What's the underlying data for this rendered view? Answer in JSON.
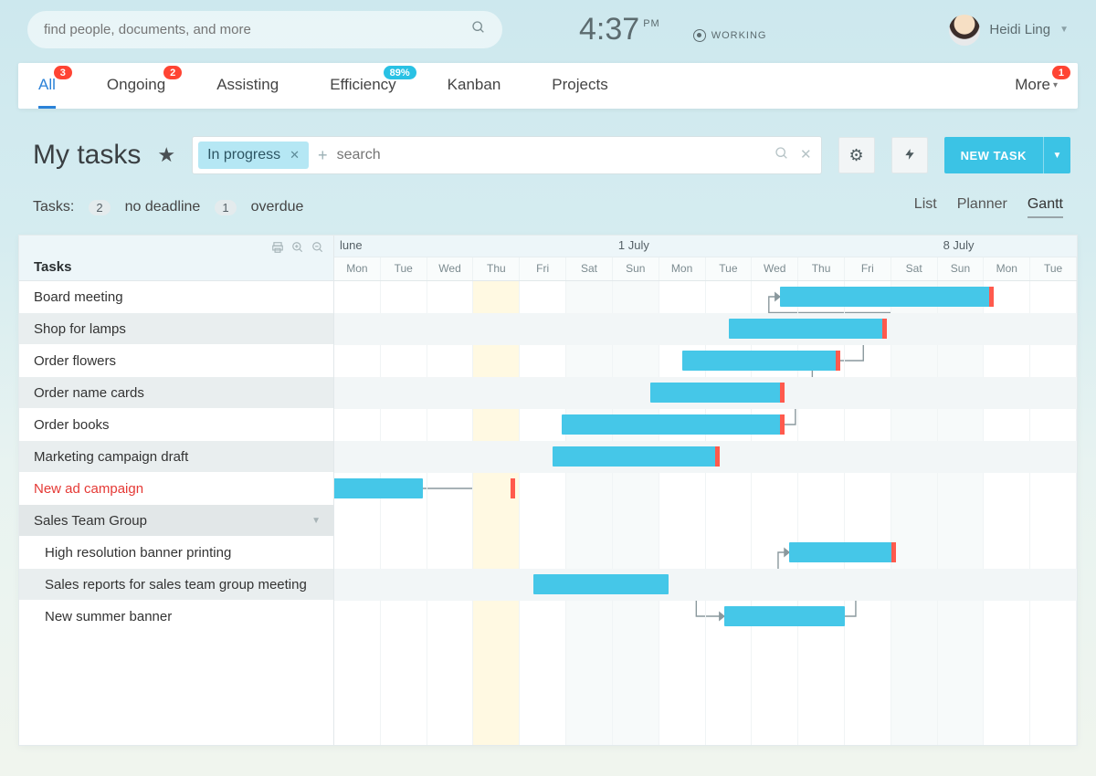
{
  "header": {
    "search_placeholder": "find people, documents, and more",
    "time": "4:37",
    "ampm": "PM",
    "status": "WORKING",
    "user_name": "Heidi Ling"
  },
  "tabs": {
    "items": [
      {
        "label": "All",
        "badge": "3",
        "badge_kind": "red",
        "active": true
      },
      {
        "label": "Ongoing",
        "badge": "2",
        "badge_kind": "red"
      },
      {
        "label": "Assisting"
      },
      {
        "label": "Efficiency",
        "badge": "89%",
        "badge_kind": "teal"
      },
      {
        "label": "Kanban"
      },
      {
        "label": "Projects"
      }
    ],
    "more_label": "More",
    "more_badge": "1"
  },
  "title": {
    "page_title": "My tasks",
    "filter_chip": "In progress",
    "filter_placeholder": "search",
    "new_task_label": "NEW TASK"
  },
  "status_row": {
    "prefix": "Tasks:",
    "no_deadline_count": "2",
    "no_deadline_label": "no deadline",
    "overdue_count": "1",
    "overdue_label": "overdue",
    "views": [
      {
        "label": "List"
      },
      {
        "label": "Planner"
      },
      {
        "label": "Gantt",
        "active": true
      }
    ]
  },
  "gantt": {
    "tasks_header": "Tasks",
    "week_labels": {
      "june": "lune",
      "jul1": "1 July",
      "jul8": "8 July"
    },
    "days": [
      "Mon",
      "Tue",
      "Wed",
      "Thu",
      "Fri",
      "Sat",
      "Sun",
      "Mon",
      "Tue",
      "Wed",
      "Thu",
      "Fri",
      "Sat",
      "Sun",
      "Mon",
      "Tue"
    ],
    "tasks": [
      {
        "label": "Board meeting"
      },
      {
        "label": "Shop for lamps"
      },
      {
        "label": "Order flowers"
      },
      {
        "label": "Order name cards"
      },
      {
        "label": "Order books"
      },
      {
        "label": "Marketing campaign draft"
      },
      {
        "label": "New ad campaign",
        "overdue": true
      },
      {
        "label": "Sales Team Group",
        "group": true
      },
      {
        "label": "High resolution banner printing"
      },
      {
        "label": "Sales reports for sales team group meeting"
      },
      {
        "label": "New summer banner"
      }
    ]
  },
  "chart_data": {
    "type": "gantt",
    "x_unit": "day_index",
    "x_origin_label": "Mon 24 June",
    "days": [
      "Mon",
      "Tue",
      "Wed",
      "Thu",
      "Fri",
      "Sat",
      "Sun",
      "Mon",
      "Tue",
      "Wed",
      "Thu",
      "Fri",
      "Sat",
      "Sun",
      "Mon",
      "Tue"
    ],
    "today_index": 3,
    "week_markers": [
      {
        "label": "lune",
        "start_index": 0
      },
      {
        "label": "1 July",
        "start_index": 6
      },
      {
        "label": "8 July",
        "start_index": 13
      }
    ],
    "bars": [
      {
        "task": "Board meeting",
        "row": 0,
        "start": 9.6,
        "end": 14.2,
        "deadline_marker": true
      },
      {
        "task": "Shop for lamps",
        "row": 1,
        "start": 8.5,
        "end": 11.9,
        "deadline_marker": true
      },
      {
        "task": "Order flowers",
        "row": 2,
        "start": 7.5,
        "end": 10.9,
        "deadline_marker": true
      },
      {
        "task": "Order name cards",
        "row": 3,
        "start": 6.8,
        "end": 9.7,
        "deadline_marker": true
      },
      {
        "task": "Order books",
        "row": 4,
        "start": 4.9,
        "end": 9.7,
        "deadline_marker": true
      },
      {
        "task": "Marketing campaign draft",
        "row": 5,
        "start": 4.7,
        "end": 8.3,
        "deadline_marker": true
      },
      {
        "task": "New ad campaign",
        "row": 6,
        "start": -0.2,
        "end": 1.9,
        "deadline_marker": true,
        "deadline_offset": 3.8
      },
      {
        "task": "High resolution banner printing",
        "row": 8,
        "start": 9.8,
        "end": 12.1,
        "deadline_marker": true
      },
      {
        "task": "Sales reports for sales team group meeting",
        "row": 9,
        "start": 4.3,
        "end": 7.2
      },
      {
        "task": "New summer banner",
        "row": 10,
        "start": 8.4,
        "end": 11.0
      }
    ],
    "connectors": [
      {
        "from_row": 1,
        "from_x": 11.9,
        "to_row": 0,
        "to_x": 9.6
      },
      {
        "from_row": 2,
        "from_x": 10.9,
        "to_row": 1,
        "to_x": 11.9
      },
      {
        "from_row": 3,
        "from_x": 9.7,
        "to_row": 2,
        "to_x": 10.9
      },
      {
        "from_row": 4,
        "from_x": 9.7,
        "to_row": 3,
        "to_x": 9.7
      },
      {
        "from_row": 6,
        "from_x": 1.9,
        "to_row": 5,
        "to_x": 4.7
      },
      {
        "from_row": 9,
        "from_x": 7.2,
        "to_row": 10,
        "to_x": 8.4
      },
      {
        "from_row": 10,
        "from_x": 11.0,
        "to_row": 8,
        "to_x": 9.8
      }
    ],
    "colors": {
      "bar": "#45c7e8",
      "deadline_cap": "#ff5a4d",
      "today_highlight": "#fff9e2"
    }
  }
}
